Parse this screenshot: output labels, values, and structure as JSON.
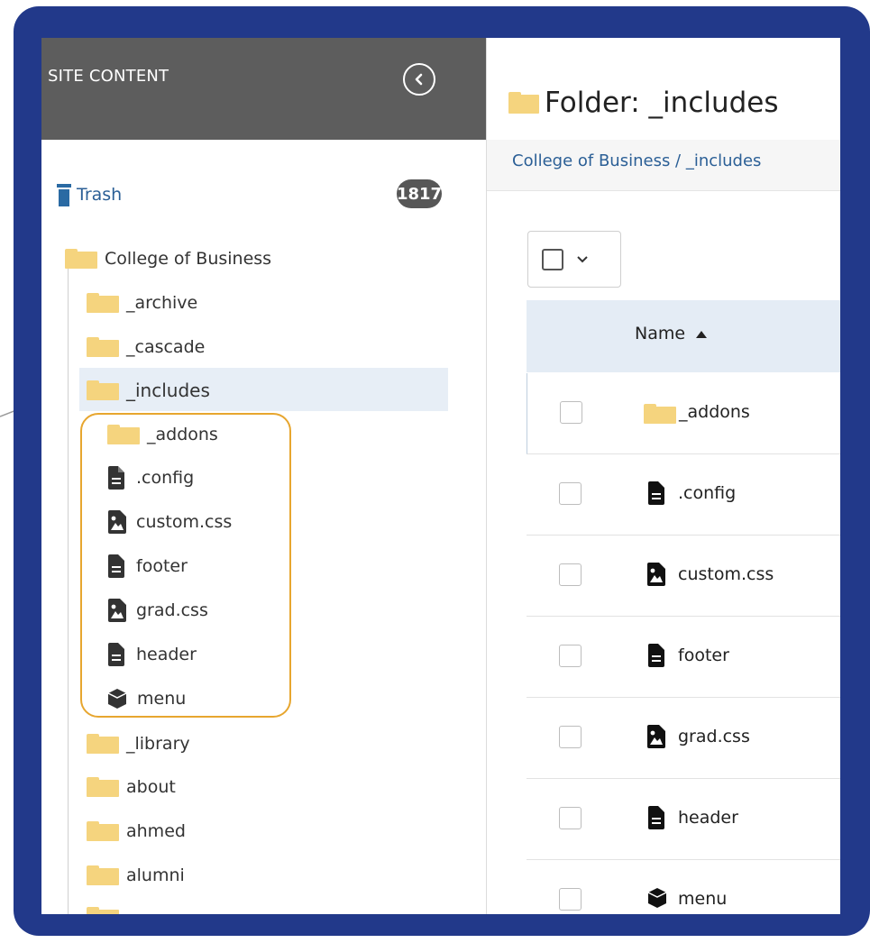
{
  "sidebar": {
    "title": "SITE CONTENT",
    "trash": {
      "label": "Trash",
      "count": "1817"
    },
    "root": "College of Business",
    "items_before": [
      "_archive",
      "_cascade"
    ],
    "selected": "_includes",
    "children": [
      {
        "label": "_addons",
        "icon": "folder-icon"
      },
      {
        "label": ".config",
        "icon": "file-icon"
      },
      {
        "label": "custom.css",
        "icon": "image-file-icon"
      },
      {
        "label": "footer",
        "icon": "file-icon"
      },
      {
        "label": "grad.css",
        "icon": "image-file-icon"
      },
      {
        "label": "header",
        "icon": "file-icon"
      },
      {
        "label": "menu",
        "icon": "block-icon"
      }
    ],
    "items_after": [
      "_library",
      "about",
      "ahmed",
      "alumni"
    ]
  },
  "main": {
    "title": "Folder: _includes",
    "breadcrumb": "College of Business / _includes",
    "column_name": "Name",
    "rows": [
      {
        "label": "_addons",
        "icon": "folder-icon"
      },
      {
        "label": ".config",
        "icon": "file-icon"
      },
      {
        "label": "custom.css",
        "icon": "image-file-icon"
      },
      {
        "label": "footer",
        "icon": "file-icon"
      },
      {
        "label": "grad.css",
        "icon": "image-file-icon"
      },
      {
        "label": "header",
        "icon": "file-icon"
      },
      {
        "label": "menu",
        "icon": "block-icon"
      }
    ]
  },
  "colors": {
    "frame": "#22398a",
    "sidebar_header": "#5d5d5d",
    "folder": "#f5d47e",
    "selection": "#e7eef6",
    "highlight_box": "#e7a62f",
    "link": "#2b5f96"
  }
}
